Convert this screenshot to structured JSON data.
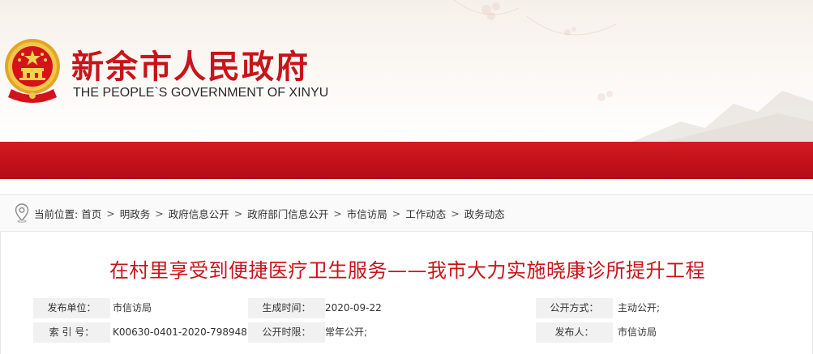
{
  "header": {
    "title": "新余市人民政府",
    "subtitle": "THE PEOPLE`S GOVERNMENT OF XINYU",
    "emblem_icon": "national-emblem-icon"
  },
  "colors": {
    "brand_red": "#c8141a",
    "nav_red": "#c4101a",
    "label_bg": "#f1f1f1"
  },
  "breadcrumb": {
    "prefix": "当前位置:",
    "separator": ">",
    "items": [
      "首页",
      "明政务",
      "政府信息公开",
      "政府部门信息公开",
      "市信访局",
      "工作动态",
      "政务动态"
    ]
  },
  "article": {
    "title": "在村里享受到便捷医疗卫生服务——我市大力实施晓康诊所提升工程"
  },
  "meta": {
    "rows": [
      [
        {
          "label": "发布单位：",
          "value": "市信访局"
        },
        {
          "label": "生成时间：",
          "value": "2020-09-22"
        },
        {
          "label": "公开方式：",
          "value": "主动公开;"
        }
      ],
      [
        {
          "label": "索 引 号：",
          "value": "K00630-0401-2020-798948"
        },
        {
          "label": "公开时限：",
          "value": "常年公开;"
        },
        {
          "label": "发布人：",
          "value": "市信访局"
        }
      ]
    ]
  }
}
